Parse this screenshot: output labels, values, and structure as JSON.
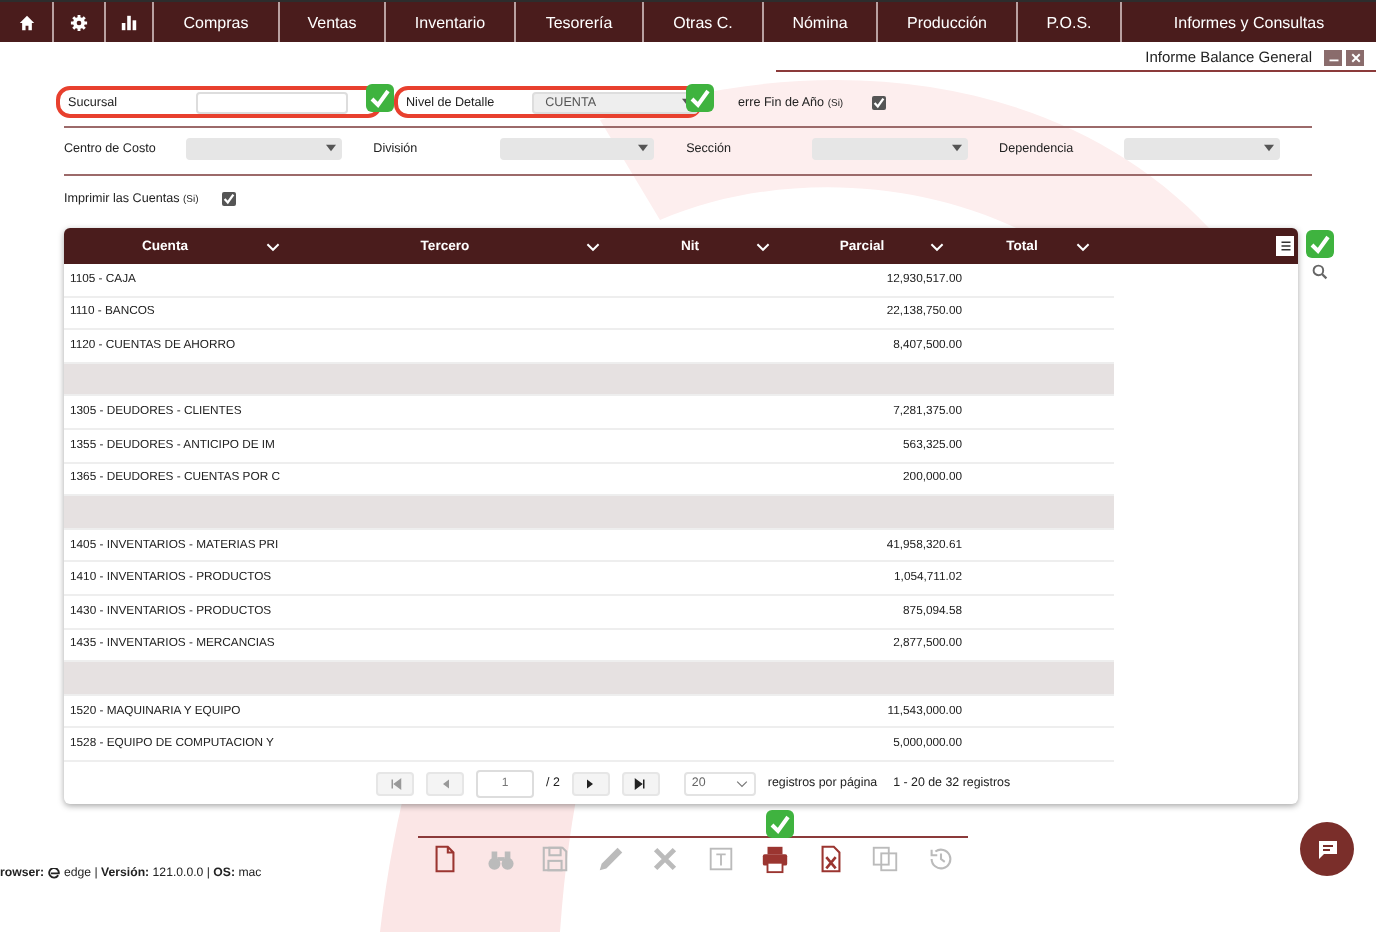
{
  "menu": [
    {
      "kind": "home"
    },
    {
      "kind": "settings"
    },
    {
      "kind": "chart"
    },
    {
      "label": "Compras"
    },
    {
      "label": "Ventas"
    },
    {
      "label": "Inventario"
    },
    {
      "label": "Tesorería"
    },
    {
      "label": "Otras C."
    },
    {
      "label": "Nómina"
    },
    {
      "label": "Producción"
    },
    {
      "label": "P.O.S."
    },
    {
      "label": "Informes y Consultas"
    }
  ],
  "window": {
    "title": "Informe Balance General"
  },
  "filters": [
    {
      "label": "Sucursal",
      "validated": true
    },
    {
      "label": "Nivel de Detalle",
      "value": "CUENTA",
      "validated": true
    }
  ],
  "year_end": {
    "label": "erre Fin de Año",
    "hint": "(Si)",
    "checked": true
  },
  "selects": [
    {
      "label": "Centro de Costo"
    },
    {
      "label": "División"
    },
    {
      "label": "Sección"
    },
    {
      "label": "Dependencia"
    }
  ],
  "print_accounts": {
    "label": "Imprimir las Cuentas",
    "hint": "(Si)",
    "checked": true
  },
  "table": {
    "columns": [
      "Cuenta",
      "Tercero",
      "Nit",
      "Parcial",
      "Total"
    ],
    "rows": [
      {
        "kind": "data",
        "cuenta": "1105 - CAJA",
        "parcial": "12,930,517.00"
      },
      {
        "kind": "data",
        "cuenta": "1110 - BANCOS",
        "parcial": "22,138,750.00"
      },
      {
        "kind": "data",
        "cuenta": "1120 - CUENTAS DE AHORRO",
        "parcial": "8,407,500.00"
      },
      {
        "kind": "separator"
      },
      {
        "kind": "data",
        "cuenta": "1305 - DEUDORES - CLIENTES",
        "parcial": "7,281,375.00"
      },
      {
        "kind": "data",
        "cuenta": "1355 - DEUDORES - ANTICIPO DE IM",
        "parcial": "563,325.00"
      },
      {
        "kind": "data",
        "cuenta": "1365 - DEUDORES - CUENTAS POR C",
        "parcial": "200,000.00"
      },
      {
        "kind": "separator"
      },
      {
        "kind": "data",
        "cuenta": "1405 - INVENTARIOS - MATERIAS PRI",
        "parcial": "41,958,320.61"
      },
      {
        "kind": "data",
        "cuenta": "1410 - INVENTARIOS - PRODUCTOS",
        "parcial": "1,054,711.02"
      },
      {
        "kind": "data",
        "cuenta": "1430 - INVENTARIOS - PRODUCTOS",
        "parcial": "875,094.58"
      },
      {
        "kind": "data",
        "cuenta": "1435 - INVENTARIOS - MERCANCIAS",
        "parcial": "2,877,500.00"
      },
      {
        "kind": "separator"
      },
      {
        "kind": "data",
        "cuenta": "1520 - MAQUINARIA Y EQUIPO",
        "parcial": "11,543,000.00"
      },
      {
        "kind": "data",
        "cuenta": "1528 - EQUIPO DE COMPUTACION Y",
        "parcial": "5,000,000.00"
      }
    ]
  },
  "pager": {
    "page": "1",
    "pages": "/ 2",
    "page_size": "20",
    "per_page_label": "registros por página",
    "summary": "1 - 20 de 32 registros"
  },
  "toolbar": [
    {
      "kind": "new",
      "disabled": false
    },
    {
      "kind": "search",
      "disabled": true
    },
    {
      "kind": "save",
      "disabled": true
    },
    {
      "kind": "edit",
      "disabled": true
    },
    {
      "kind": "delete",
      "disabled": true
    },
    {
      "kind": "text",
      "disabled": true
    },
    {
      "kind": "print",
      "disabled": false
    },
    {
      "kind": "excel",
      "disabled": false
    },
    {
      "kind": "copy",
      "disabled": true
    },
    {
      "kind": "history",
      "disabled": true
    }
  ],
  "footer": {
    "browser": "**rowser:**",
    "info": "edge | **Versión:** 121.0.0.0 | **OS:** mac"
  }
}
